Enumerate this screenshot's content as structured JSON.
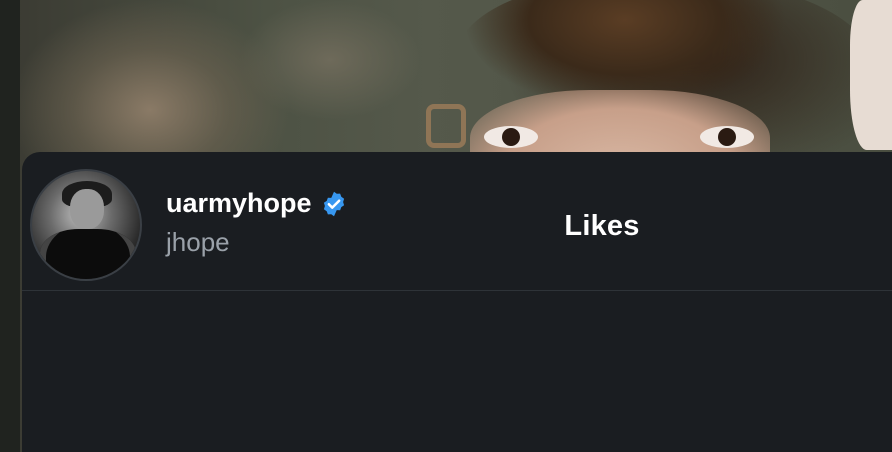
{
  "sheet": {
    "title": "Likes"
  },
  "likes": [
    {
      "username": "uarmyhope",
      "verified": true,
      "full_name": "jhope"
    }
  ],
  "colors": {
    "sheet_background": "#1a1d21",
    "verified_badge": "#3797f0",
    "secondary_text": "#9aa1a9"
  }
}
